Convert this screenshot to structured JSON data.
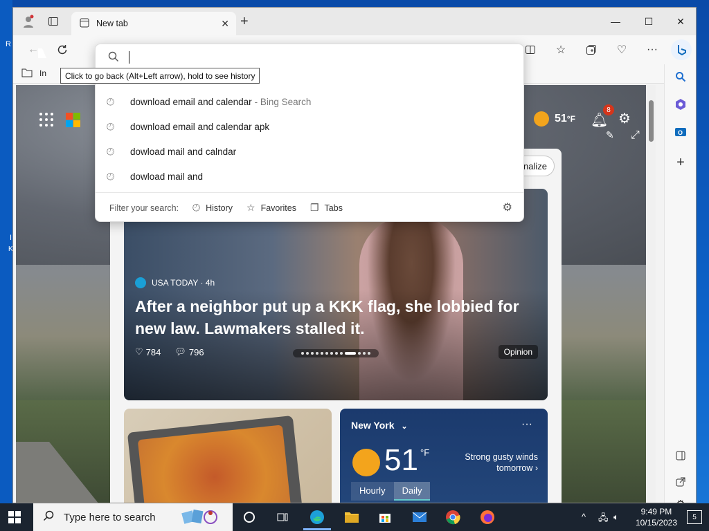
{
  "desktop_edge": {
    "glyph_top": "R",
    "glyph_mid": "I",
    "glyph_low": "K"
  },
  "browser": {
    "tab": {
      "title": "New tab",
      "close": "✕"
    },
    "new_tab": "+",
    "window_controls": {
      "minimize": "—",
      "maximize": "☐",
      "close": "✕"
    },
    "favorites_bar": {
      "folder_label": "In"
    }
  },
  "address_dropdown": {
    "query": "",
    "suggestions": [
      {
        "text": "download email and calendar",
        "suffix": "- Bing Search"
      },
      {
        "text": "download email and calendar apk",
        "suffix": ""
      },
      {
        "text": "dowload mail and calndar",
        "suffix": ""
      },
      {
        "text": "dowload mail and",
        "suffix": ""
      }
    ],
    "filter_label": "Filter your search:",
    "filters": [
      "History",
      "Favorites",
      "Tabs"
    ]
  },
  "tooltip": {
    "text": "Click to go back (Alt+Left arrow), hold to see history"
  },
  "newtab_page": {
    "weather_temp": "51",
    "weather_unit": "°F",
    "notification_count": "8",
    "personalize_label": "onalize",
    "hero": {
      "source": "USA TODAY · 4h",
      "headline": "After a neighbor put up a KKK flag, she lobbied for new law. Lawmakers stalled it.",
      "likes": "784",
      "comments": "796",
      "tag": "Opinion"
    },
    "weather_card": {
      "city": "New York",
      "temp": "51",
      "unit": "°F",
      "wind": "Strong gusty winds tomorrow",
      "tabs": [
        "Hourly",
        "Daily"
      ],
      "selected_tab": "Daily",
      "more": "···"
    }
  },
  "taskbar": {
    "search_placeholder": "Type here to search",
    "time": "9:49 PM",
    "date": "10/15/2023",
    "notification_count": "5"
  },
  "colors": {
    "accent": "#0f6cbd",
    "taskbar": "#1b2430",
    "badge": "#d6351b"
  },
  "icons": [
    "back-icon",
    "refresh-icon",
    "search-icon",
    "history-icon",
    "star-icon",
    "tabs-icon",
    "gear-icon",
    "bell-icon",
    "copilot-icon",
    "outlook-icon",
    "edge-icon",
    "chrome-icon",
    "firefox-icon",
    "file-explorer-icon",
    "mail-icon",
    "store-icon"
  ]
}
